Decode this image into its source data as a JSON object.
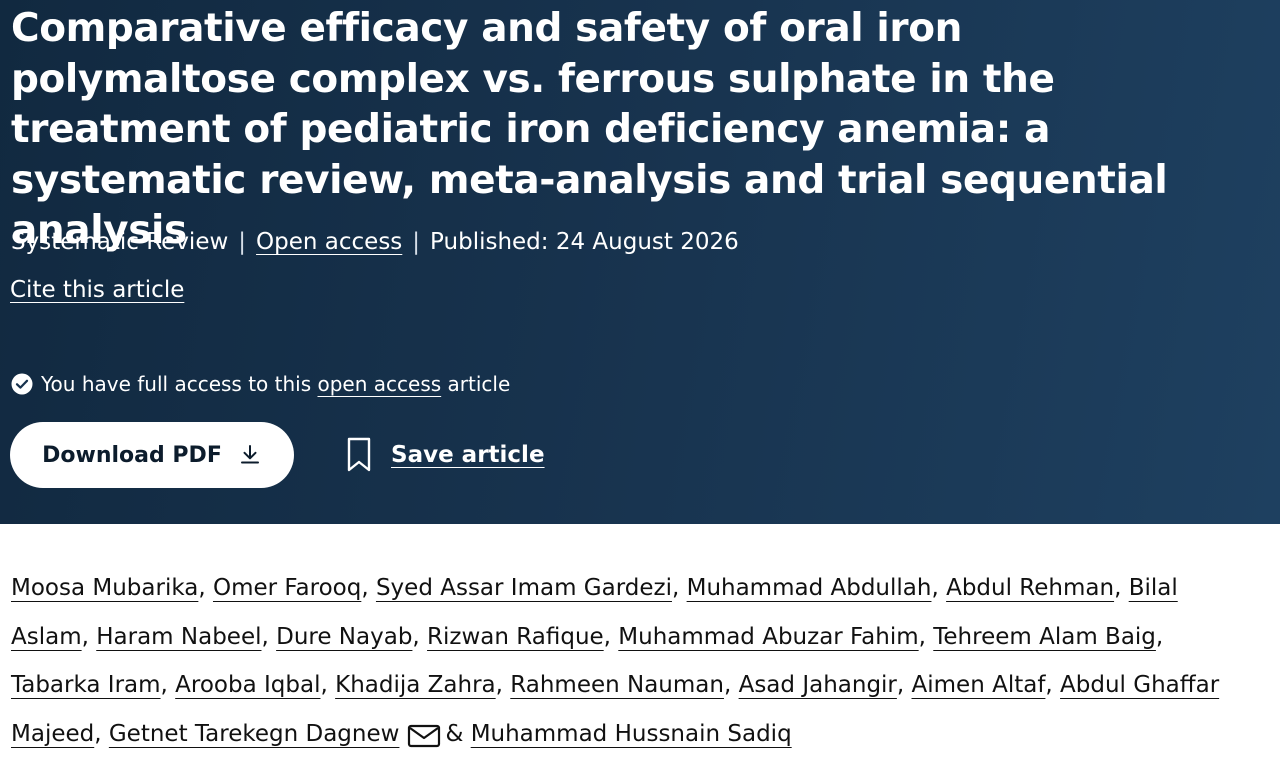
{
  "article": {
    "title": "Comparative efficacy and safety of oral iron polymaltose complex vs. ferrous sulphate in the treatment of pediatric iron deficiency anemia: a systematic review, meta-analysis and trial sequential analysis",
    "type": "Systematic Review",
    "access_link": "Open access",
    "published": "Published: 24 August 2026",
    "cite_label": "Cite this article"
  },
  "access_notice": {
    "prefix": "You have full access to this",
    "link": "open access",
    "suffix": "article"
  },
  "actions": {
    "download_label": "Download PDF",
    "save_label": "Save article"
  },
  "authors": [
    "Moosa Mubarika",
    "Omer Farooq",
    "Syed Assar Imam Gardezi",
    "Muhammad Abdullah",
    "Abdul Rehman",
    "Bilal Aslam",
    "Haram Nabeel",
    "Dure Nayab",
    "Rizwan Rafique",
    "Muhammad Abuzar Fahim",
    "Tehreem Alam Baig",
    "Tabarka Iram",
    "Arooba Iqbal",
    "Khadija Zahra",
    "Rahmeen Nauman",
    "Asad Jahangir",
    "Aimen Altaf",
    "Abdul Ghaffar Majeed",
    "Getnet Tarekegn Dagnew",
    "Muhammad Hussnain Sadiq"
  ],
  "author_ampersand": "&",
  "colors": {
    "hero_bg": "#17324d",
    "text_dark": "#111111"
  },
  "icons": {
    "access": "check-circle-icon",
    "download": "download-icon",
    "save": "bookmark-icon",
    "corresponding": "envelope-icon"
  }
}
